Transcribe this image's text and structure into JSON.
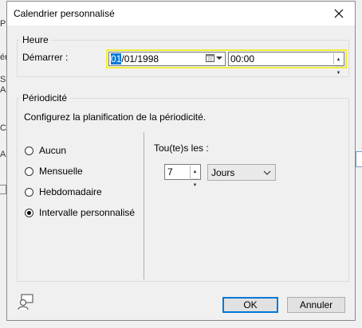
{
  "background": {
    "frag1": "P",
    "frag2": "ér",
    "frag3": "S",
    "frag4": "A",
    "frag5": "C",
    "frag6": "A"
  },
  "dialog": {
    "title": "Calendrier personnalisé",
    "close_icon": "close-icon"
  },
  "time_group": {
    "legend": "Heure",
    "start_label": "Démarrer :",
    "date_selected": "01",
    "date_rest": "/01/1998",
    "time_value": "00:00",
    "calendar_icon": "calendar-icon"
  },
  "recurrence_group": {
    "legend": "Périodicité",
    "description": "Configurez la planification de la périodicité.",
    "options": [
      {
        "label": "Aucun",
        "checked": false
      },
      {
        "label": "Mensuelle",
        "checked": false
      },
      {
        "label": "Hebdomadaire",
        "checked": false
      },
      {
        "label": "Intervalle personnalisé",
        "checked": true
      }
    ],
    "every_label": "Tou(te)s les :",
    "interval_value": "7",
    "unit_value": "Jours"
  },
  "buttons": {
    "ok": "OK",
    "cancel": "Annuler"
  },
  "colors": {
    "highlight": "#f2ef3a",
    "selection": "#0078d7"
  }
}
